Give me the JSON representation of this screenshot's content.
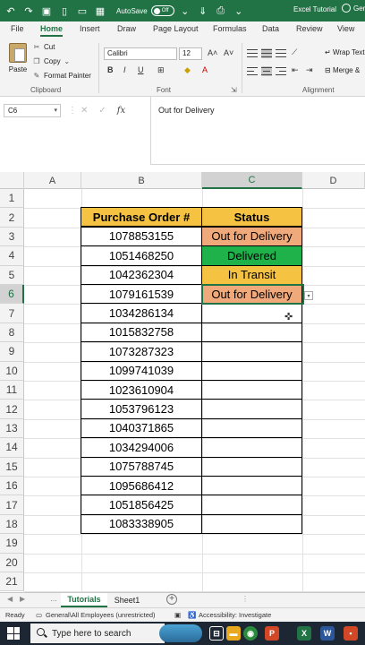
{
  "titlebar": {
    "autosave_label": "AutoSave",
    "autosave_state": "Off",
    "doc_title": "Excel Tutorial",
    "user_label": "Gen"
  },
  "ribbon_tabs": [
    "File",
    "Home",
    "Insert",
    "Draw",
    "Page Layout",
    "Formulas",
    "Data",
    "Review",
    "View"
  ],
  "ribbon_active_tab": "Home",
  "clipboard": {
    "paste": "Paste",
    "cut": "Cut",
    "copy": "Copy",
    "format_painter": "Format Painter",
    "group_label": "Clipboard"
  },
  "font": {
    "name": "Calibri",
    "size": "12",
    "bold": "B",
    "italic": "I",
    "underline": "U",
    "group_label": "Font"
  },
  "alignment": {
    "wrap_text": "Wrap Text",
    "merge": "Merge &",
    "group_label": "Alignment"
  },
  "formula_bar": {
    "name_box": "C6",
    "fx": "fx",
    "content": "Out for Delivery"
  },
  "columns": [
    "A",
    "B",
    "C",
    "D"
  ],
  "selected_column": "C",
  "selected_row": 6,
  "rows": [
    "1",
    "2",
    "3",
    "4",
    "5",
    "6",
    "7",
    "8",
    "9",
    "10",
    "11",
    "12",
    "13",
    "14",
    "15",
    "16",
    "17",
    "18",
    "19",
    "20",
    "21"
  ],
  "table": {
    "header_po": "Purchase Order #",
    "header_status": "Status",
    "po_numbers": [
      "1078853155",
      "1051468250",
      "1042362304",
      "1079161539",
      "1034286134",
      "1015832758",
      "1073287323",
      "1099741039",
      "1023610904",
      "1053796123",
      "1040371865",
      "1034294006",
      "1075788745",
      "1095686412",
      "1051856425",
      "1083338905"
    ],
    "statuses": [
      "Out for Delivery",
      "Delivered",
      "In Transit",
      "Out for Delivery",
      "",
      "",
      "",
      "",
      "",
      "",
      "",
      "",
      "",
      "",
      "",
      ""
    ]
  },
  "status_colors": {
    "Out for Delivery": "#f0a97a",
    "Delivered": "#1fb24a",
    "In Transit": "#f5c242",
    "header": "#f5c242",
    "accent": "#217346"
  },
  "sheets": [
    "Tutorials",
    "Sheet1"
  ],
  "active_sheet": "Tutorials",
  "status_bar": {
    "ready": "Ready",
    "sensitivity": "General\\All Employees (unrestricted)",
    "accessibility": "Accessibility: Investigate"
  },
  "taskbar": {
    "search_placeholder": "Type here to search"
  }
}
